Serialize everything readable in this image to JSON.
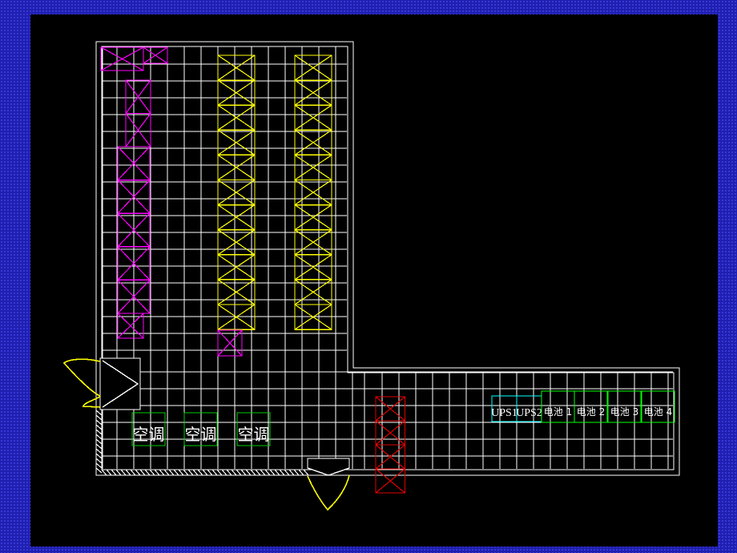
{
  "colors": {
    "background": "#1f1fb0",
    "canvas": "#000000",
    "grid": "#ffffff",
    "cabinet_magenta": "#ff00ff",
    "cabinet_yellow": "#ffff00",
    "cabinet_red": "#e00000",
    "ups": "#00ffff",
    "battery": "#00ff00",
    "air_conditioner": "#00cc00",
    "door": "#ffff00"
  },
  "icons": {
    "door_swing": "door-swing-arc",
    "cabinet": "crossed-box"
  },
  "labels": {
    "air_conditioner": [
      "空调",
      "空调",
      "空调"
    ],
    "ups": [
      "UPS1",
      "UPS2"
    ],
    "battery": [
      "电池 1",
      "电池 2",
      "电池 3",
      "电池 4"
    ]
  }
}
